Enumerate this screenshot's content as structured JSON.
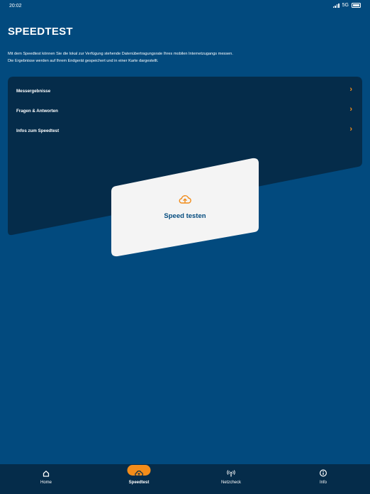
{
  "status_bar": {
    "time": "20:02",
    "network": "5G"
  },
  "page": {
    "title": "SPEEDTEST",
    "description_line1": "Mit dem Speedtest können Sie die lokal zur Verfügung stehende Datenübertragungsrate Ihres mobilen Internetzugangs messen.",
    "description_line2": "Die Ergebnisse werden auf Ihrem Endgerät gespeichert und in einer Karte dargestellt."
  },
  "menu": {
    "items": [
      {
        "label": "Messergebnisse"
      },
      {
        "label": "Fragen & Antworten"
      },
      {
        "label": "Infos zum Speedtest"
      }
    ]
  },
  "card": {
    "label": "Speed testen",
    "icon": "cloud-upload-icon"
  },
  "tabbar": {
    "tabs": [
      {
        "label": "Home",
        "icon": "home-icon"
      },
      {
        "label": "Speedtest",
        "icon": "speedtest-icon",
        "active": true
      },
      {
        "label": "Netzcheck",
        "icon": "antenna-icon"
      },
      {
        "label": "Info",
        "icon": "info-icon"
      }
    ]
  },
  "colors": {
    "background": "#024a7e",
    "panel": "#052c4a",
    "accent": "#f28c1a",
    "card": "#f4f4f4",
    "tabbar": "#052c4a"
  }
}
